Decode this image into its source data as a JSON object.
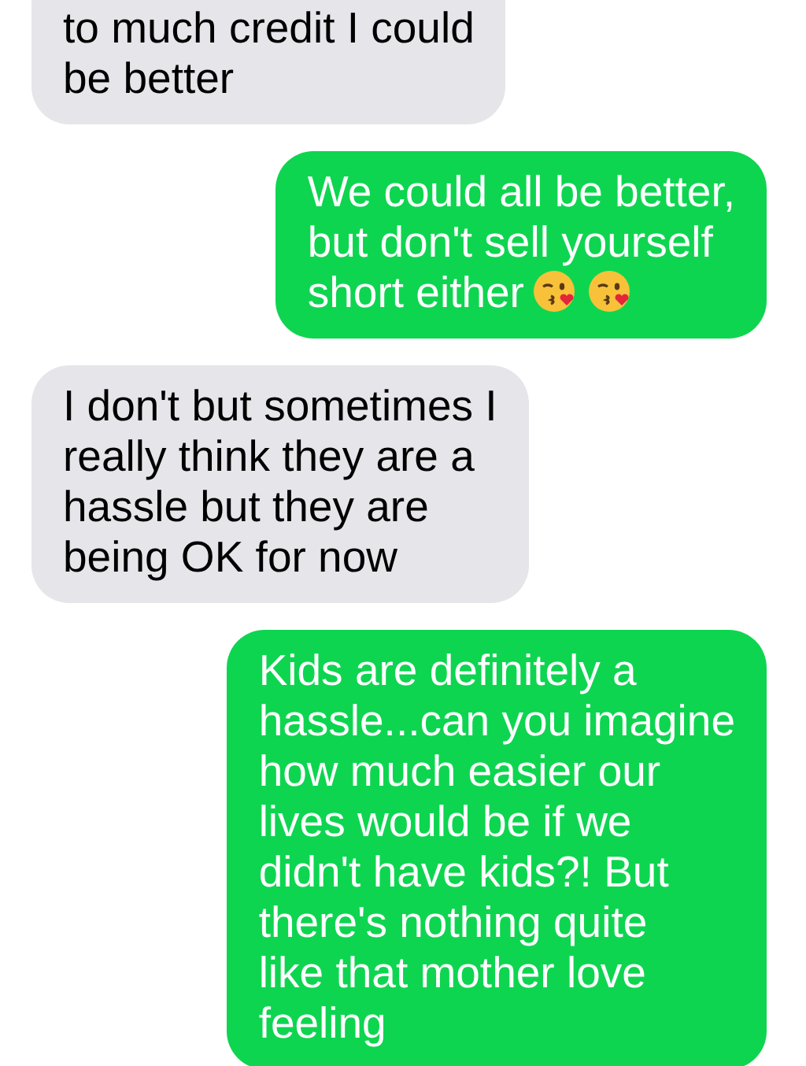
{
  "messages": [
    {
      "kind": "received",
      "lines": [
        "to much credit I could",
        "be better"
      ]
    },
    {
      "kind": "sent",
      "lines": [
        "We could all be better,",
        "but don't sell yourself",
        "short either"
      ],
      "emoji": [
        {
          "kind": "kissing-heart"
        },
        {
          "kind": "kissing-heart"
        }
      ]
    },
    {
      "kind": "received",
      "lines": [
        "I don't but sometimes I",
        "really think they are a",
        "hassle but they are",
        "being OK for now"
      ]
    },
    {
      "kind": "sent",
      "lines": [
        "Kids are definitely a",
        "hassle...can you imagine",
        "how much easier our",
        "lives would be if we",
        "didn't have kids?!  But",
        "there's nothing quite",
        "like that mother love",
        "feeling"
      ]
    }
  ]
}
